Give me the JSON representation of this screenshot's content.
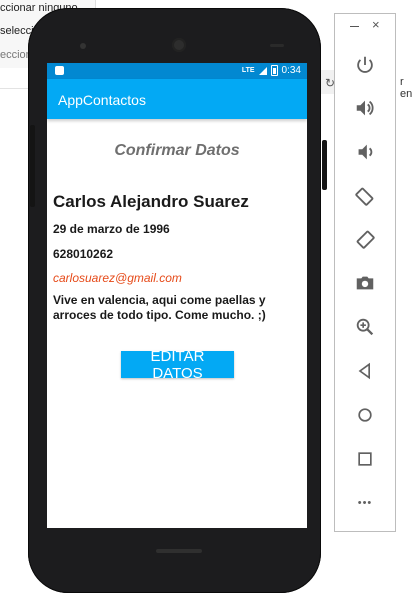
{
  "background": {
    "menu_items": [
      "ccionar ninguno",
      "selección",
      "ecciona"
    ],
    "right_text": "r en"
  },
  "status_bar": {
    "network": "LTE",
    "time": "0:34"
  },
  "app": {
    "title": "AppContactos"
  },
  "confirm": {
    "heading": "Confirmar Datos",
    "name": "Carlos Alejandro Suarez",
    "birthdate": "29 de marzo de 1996",
    "phone": "628010262",
    "email": "carlosuarez@gmail.com",
    "description": "Vive en valencia, aqui come paellas y arroces de todo tipo. Come mucho. ;)",
    "edit_button": "EDITAR DATOS"
  },
  "emulator_toolbar": {
    "close_symbol": "×",
    "more_symbol": "•••",
    "buttons": [
      "power-icon",
      "volume-up-icon",
      "volume-down-icon",
      "rotate-left-icon",
      "rotate-right-icon",
      "camera-icon",
      "zoom-in-icon",
      "back-icon",
      "home-icon",
      "overview-icon",
      "more-icon"
    ]
  },
  "colors": {
    "status_bar": "#0288d1",
    "app_bar": "#03a9f4",
    "email": "#e64a19",
    "button": "#03a9f4"
  }
}
